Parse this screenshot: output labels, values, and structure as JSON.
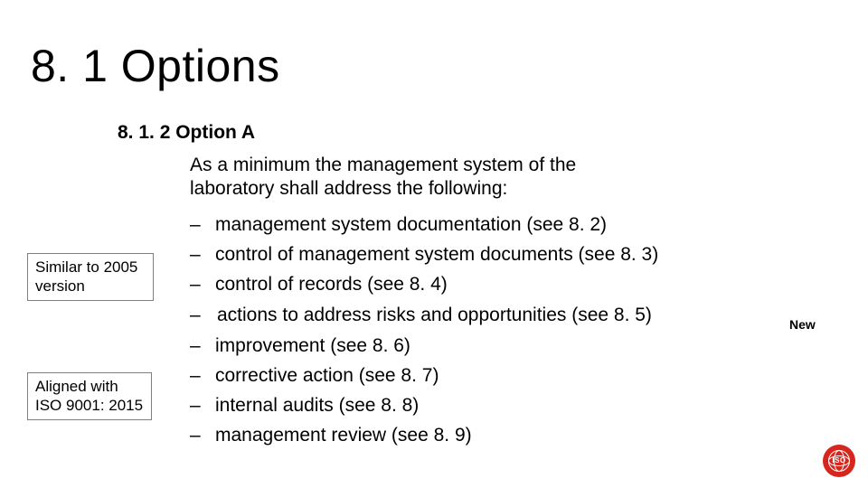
{
  "title": "8. 1   Options",
  "subheading": "8. 1. 2   Option A",
  "intro": "As a minimum the management system of the laboratory shall address the following:",
  "items": {
    "a": "management system documentation (see 8. 2)",
    "b": "control of management system documents (see 8. 3)",
    "c": "control of records (see 8. 4)",
    "d": "actions to address risks and opportunities (see 8. 5)",
    "e": "improvement (see 8. 6)",
    "f": "corrective action (see 8. 7)",
    "g": "internal audits (see 8. 8)",
    "h": "management review (see 8. 9)"
  },
  "dash": "–",
  "sidenote_top": "Similar to 2005 version",
  "sidenote_bottom": "Aligned with ISO 9001: 2015",
  "new_label": "New",
  "logo_text": "ISO"
}
